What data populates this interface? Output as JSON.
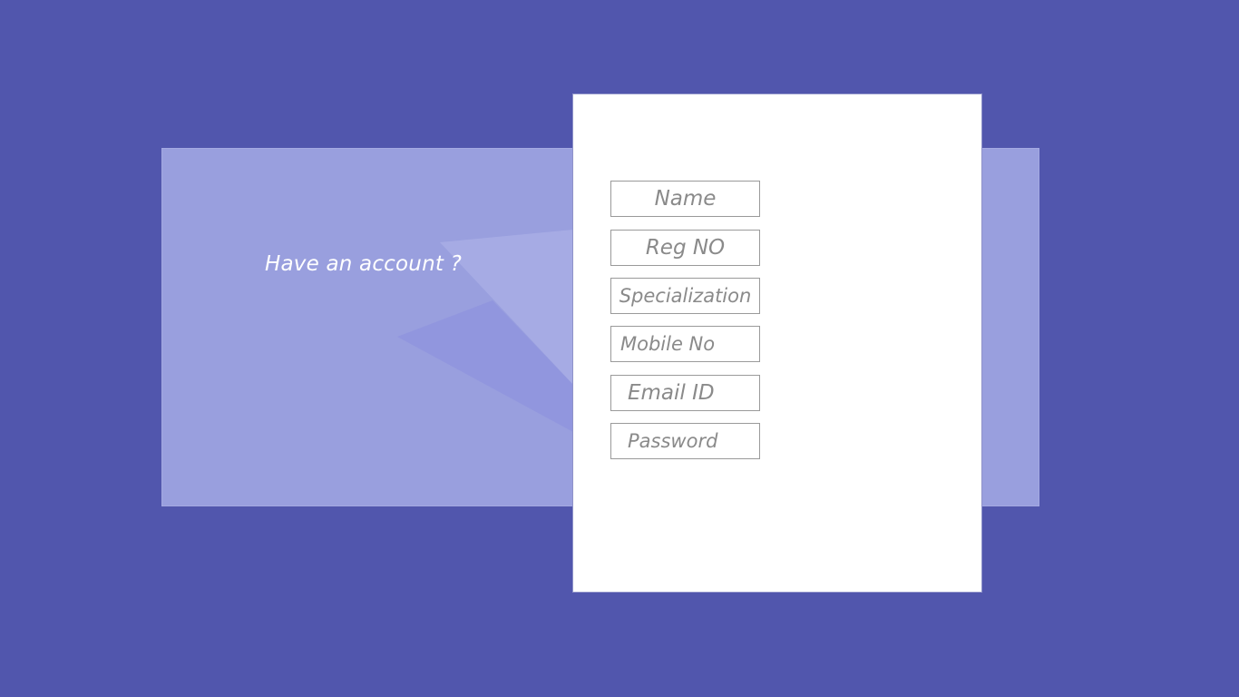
{
  "colors": {
    "background": "#5156ad",
    "panel": "#999fde",
    "card": "#ffffff",
    "field_border": "#9a9a9a",
    "field_text": "#8a8a8a",
    "prompt_text": "#ffffff"
  },
  "left_panel": {
    "prompt": "Have an account ?"
  },
  "form": {
    "fields": [
      {
        "placeholder": "Name",
        "value": ""
      },
      {
        "placeholder": "Reg NO",
        "value": ""
      },
      {
        "placeholder": "Specialization",
        "value": ""
      },
      {
        "placeholder": "Mobile No",
        "value": ""
      },
      {
        "placeholder": "Email ID",
        "value": ""
      },
      {
        "placeholder": "Password",
        "value": ""
      }
    ]
  }
}
